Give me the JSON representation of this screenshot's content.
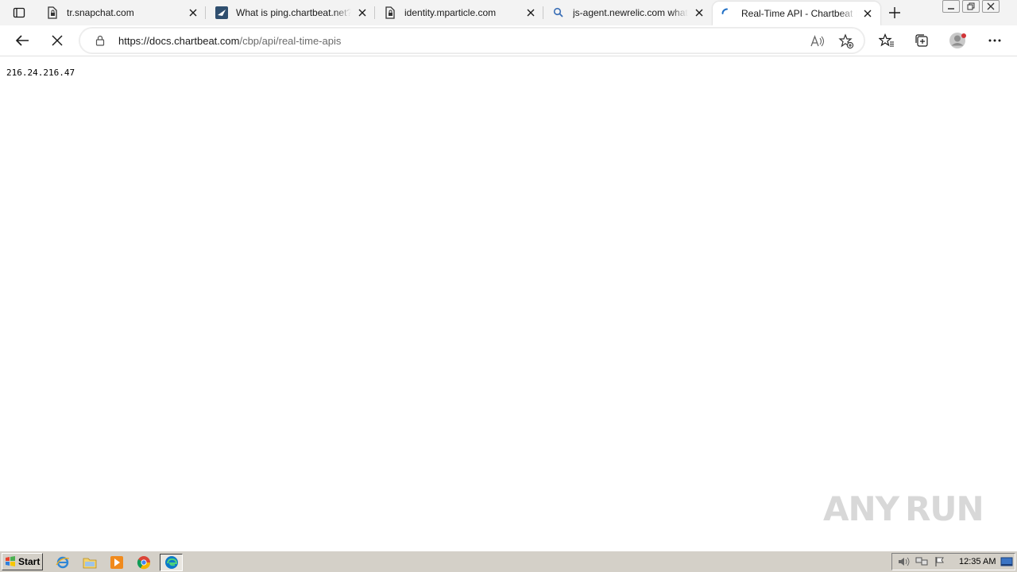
{
  "browser": {
    "tabs": [
      {
        "title": "tr.snapchat.com",
        "favicon": "page-lock-icon",
        "active": false
      },
      {
        "title": "What is ping.chartbeat.net?",
        "favicon": "site-logo-icon",
        "active": false
      },
      {
        "title": "identity.mparticle.com",
        "favicon": "page-lock-icon",
        "active": false
      },
      {
        "title": "js-agent.newrelic.com what",
        "favicon": "search-icon",
        "active": false
      },
      {
        "title": "Real-Time API - Chartbeat D",
        "favicon": "loading-spinner-icon",
        "active": true
      }
    ],
    "url_host": "https://docs.chartbeat.com",
    "url_path": "/cbp/api/real-time-apis"
  },
  "page": {
    "body_text": "216.24.216.47"
  },
  "watermark": {
    "left": "ANY",
    "right": "RUN"
  },
  "taskbar": {
    "start_label": "Start",
    "clock": "12:35 AM"
  }
}
